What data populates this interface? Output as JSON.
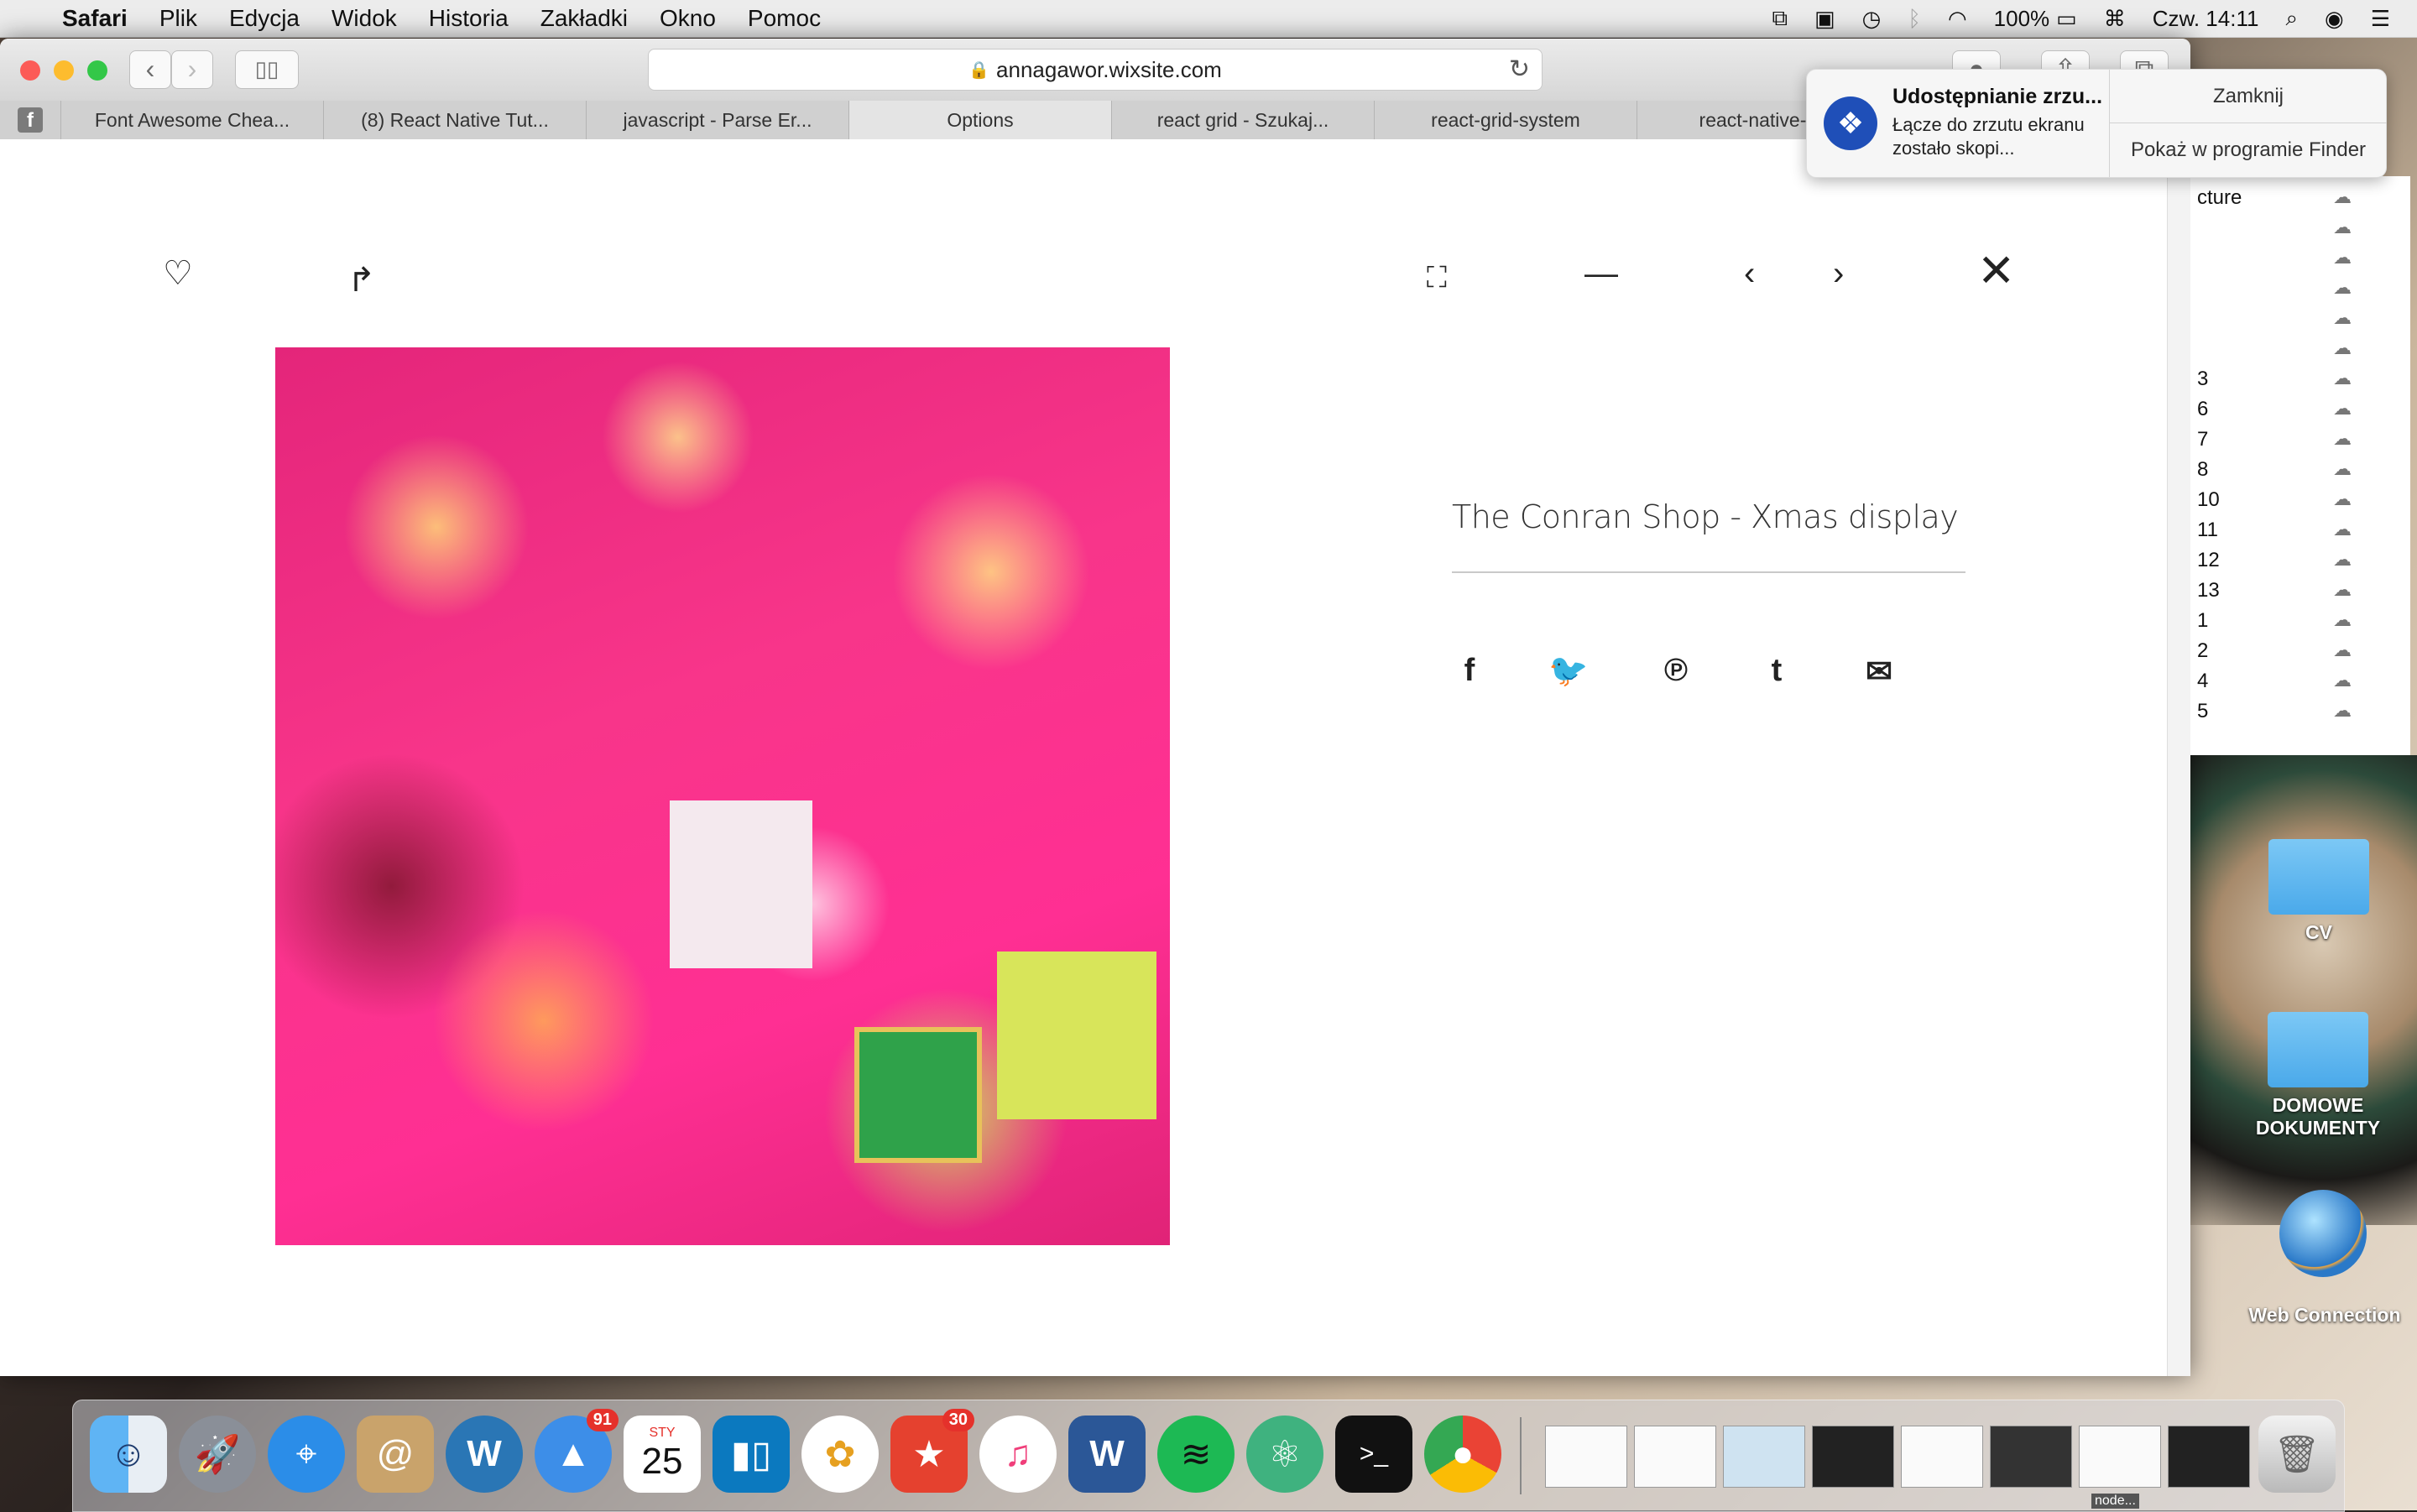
{
  "menubar": {
    "app_name": "Safari",
    "menus": [
      "Plik",
      "Edycja",
      "Widok",
      "Historia",
      "Zakładki",
      "Okno",
      "Pomoc"
    ],
    "battery": "100%",
    "clock": "Czw. 14:11"
  },
  "browser": {
    "url": "annagawor.wixsite.com",
    "tabs": [
      "Font Awesome Chea...",
      "(8) React Native Tut...",
      "javascript - Parse Er...",
      "Options",
      "react grid - Szukaj...",
      "react-grid-system",
      "react-native-bac"
    ]
  },
  "page": {
    "title": "The Conran Shop - Xmas display"
  },
  "notification": {
    "title": "Udostępnianie zrzu...",
    "body": "Łącze do zrzutu ekranu zostało skopi...",
    "close_label": "Zamknij",
    "finder_label": "Pokaż w programie Finder"
  },
  "finder": {
    "rows": [
      "cture",
      "",
      "",
      "",
      "",
      "",
      "3",
      "6",
      "7",
      "8",
      "10",
      "11",
      "12",
      "13",
      "1",
      "2",
      "4",
      "5"
    ]
  },
  "desktop": {
    "icons": [
      "CV",
      "DOMOWE DOKUMENTY",
      "Web Connection"
    ]
  },
  "dock": {
    "badge_mail": "91",
    "calendar_month": "STY",
    "calendar_day": "25",
    "badge_wunderlist": "30",
    "thumb_label": "node..."
  },
  "colors": {
    "accent_pink": "#f8358a",
    "dropbox_blue": "#1f4fb8"
  }
}
